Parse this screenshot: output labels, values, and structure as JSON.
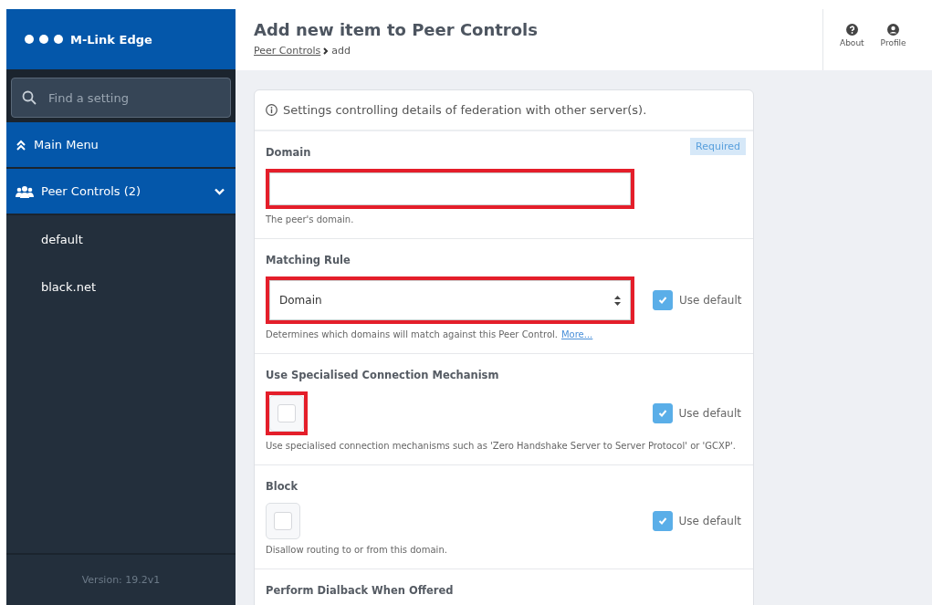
{
  "sidebar": {
    "logo_text": "M-Link Edge",
    "search": {
      "placeholder": "Find a setting"
    },
    "menu": [
      {
        "label": "Main Menu",
        "kind": "up",
        "expanded": false
      },
      {
        "label": "Peer Controls (2)",
        "kind": "group",
        "expanded": true
      }
    ],
    "items": [
      {
        "label": "default"
      },
      {
        "label": "black.net"
      }
    ],
    "version": "Version: 19.2v1"
  },
  "header": {
    "title": "Add new item to Peer Controls",
    "breadcrumb": [
      {
        "label": "Peer Controls",
        "kind": "link"
      },
      {
        "label": "add",
        "kind": "current"
      }
    ],
    "actions": [
      {
        "label": "About",
        "kind": "help"
      },
      {
        "label": "Profile",
        "kind": "user"
      }
    ]
  },
  "card": {
    "intro": "Settings controlling details of federation with other server(s).",
    "fields": [
      {
        "label": "Domain",
        "kind": "text",
        "required": "Required",
        "help": "The peer's domain.",
        "highlighted": true
      },
      {
        "label": "Matching Rule",
        "kind": "select",
        "value": "Domain",
        "use_default": {
          "label": "Use default",
          "checked": true
        },
        "help": "Determines which domains will match against this Peer Control.",
        "more": "More...",
        "highlighted": true
      },
      {
        "label": "Use Specialised Connection Mechanism",
        "kind": "checkbox",
        "checked": false,
        "use_default": {
          "label": "Use default",
          "checked": true
        },
        "help": "Use specialised connection mechanisms such as 'Zero Handshake Server to Server Protocol' or 'GCXP'.",
        "highlighted": true
      },
      {
        "label": "Block",
        "kind": "checkbox",
        "checked": false,
        "use_default": {
          "label": "Use default",
          "checked": true
        },
        "help": "Disallow routing to or from this domain.",
        "highlighted": false
      },
      {
        "label": "Perform Dialback When Offered",
        "kind": "checkbox",
        "highlighted": false
      }
    ]
  }
}
